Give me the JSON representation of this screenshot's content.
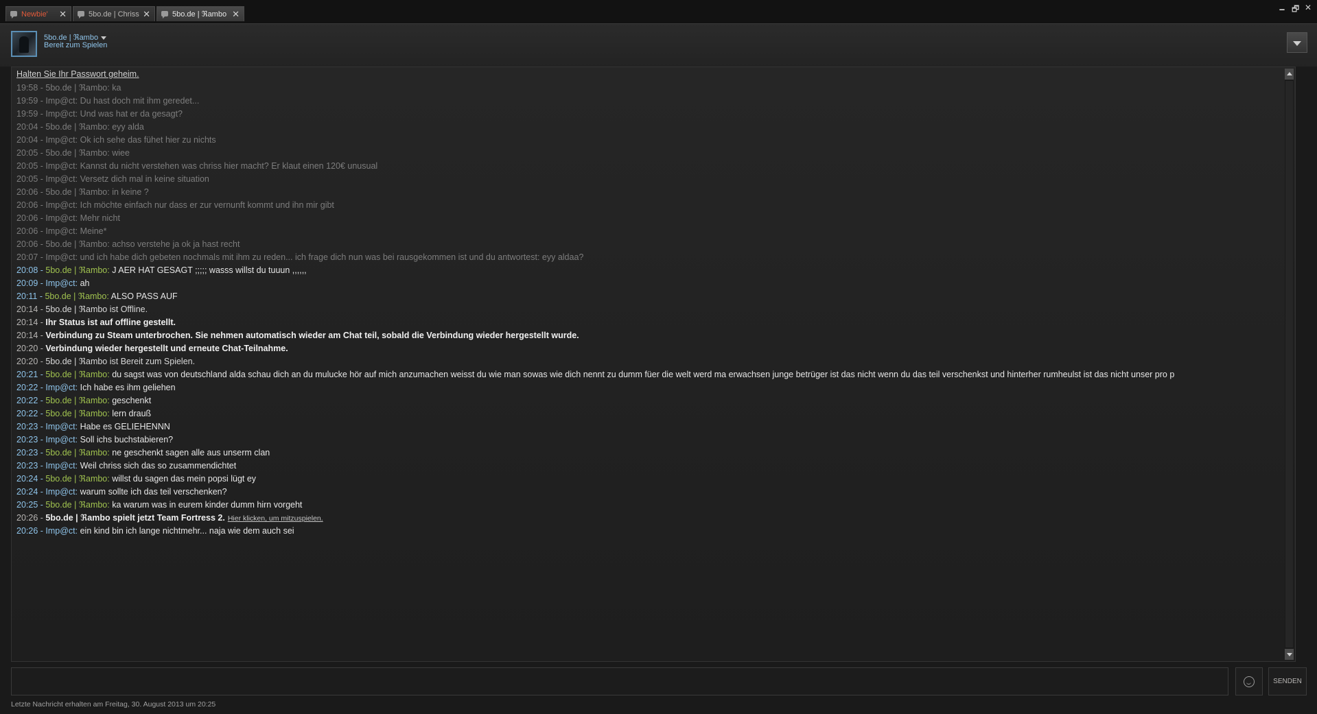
{
  "tabs": [
    {
      "label": "Newbie'",
      "close": "✕"
    },
    {
      "label": "5bo.de | Chriss",
      "close": "✕"
    },
    {
      "label": "5bo.de | ℜambo",
      "close": "✕"
    }
  ],
  "window_controls": {
    "minimize": "🗕",
    "maximize": "🗗",
    "close": "✕"
  },
  "header": {
    "name": "5bo.de | ℜambo",
    "status": "Bereit zum Spielen"
  },
  "chat": {
    "warning": "Halten Sie Ihr Passwort geheim.",
    "messages": [
      {
        "kind": "old",
        "time": "19:58",
        "sender": "5bo.de | ℜambo",
        "text": "ka"
      },
      {
        "kind": "old",
        "time": "19:59",
        "sender": "Imp@ct",
        "text": "Du hast doch mit ihm geredet..."
      },
      {
        "kind": "old",
        "time": "19:59",
        "sender": "Imp@ct",
        "text": "Und was hat er da gesagt?"
      },
      {
        "kind": "old",
        "time": "20:04",
        "sender": "5bo.de | ℜambo",
        "text": "eyy alda"
      },
      {
        "kind": "old",
        "time": "20:04",
        "sender": "Imp@ct",
        "text": "Ok ich sehe das fühet hier zu nichts"
      },
      {
        "kind": "old",
        "time": "20:05",
        "sender": "5bo.de | ℜambo",
        "text": "wiee"
      },
      {
        "kind": "old",
        "time": "20:05",
        "sender": "Imp@ct",
        "text": "Kannst du nicht verstehen was chriss hier macht? Er klaut einen 120€ unusual"
      },
      {
        "kind": "old",
        "time": "20:05",
        "sender": "Imp@ct",
        "text": "Versetz dich mal in keine situation"
      },
      {
        "kind": "old",
        "time": "20:06",
        "sender": "5bo.de | ℜambo",
        "text": "in keine ?"
      },
      {
        "kind": "old",
        "time": "20:06",
        "sender": "Imp@ct",
        "text": "Ich möchte einfach nur dass er zur vernunft kommt und ihn mir gibt"
      },
      {
        "kind": "old",
        "time": "20:06",
        "sender": "Imp@ct",
        "text": "Mehr nicht"
      },
      {
        "kind": "old",
        "time": "20:06",
        "sender": "Imp@ct",
        "text": "Meine*"
      },
      {
        "kind": "old",
        "time": "20:06",
        "sender": "5bo.de | ℜambo",
        "text": "achso verstehe ja ok ja hast recht"
      },
      {
        "kind": "old",
        "time": "20:07",
        "sender": "Imp@ct",
        "text": "und ich habe dich gebeten nochmals mit ihm zu reden... ich frage dich nun was bei rausgekommen ist und du antwortest: eyy aldaa?"
      },
      {
        "kind": "new",
        "time": "20:08",
        "sender": "5bo.de | ℜambo",
        "role": "friend",
        "text": "J AER HAT GESAGT ;;;;; wasss willst du tuuun ,,,,,,"
      },
      {
        "kind": "new",
        "time": "20:09",
        "sender": "Imp@ct",
        "role": "me",
        "text": "ah"
      },
      {
        "kind": "new",
        "time": "20:11",
        "sender": "5bo.de | ℜambo",
        "role": "friend",
        "text": "ALSO PASS AUF"
      },
      {
        "kind": "note",
        "time": "20:14",
        "text": "5bo.de | ℜambo ist Offline."
      },
      {
        "kind": "sys",
        "time": "20:14",
        "text": "Ihr Status ist auf offline gestellt."
      },
      {
        "kind": "sys",
        "time": "20:14",
        "text": "Verbindung zu Steam unterbrochen. Sie nehmen automatisch wieder am Chat teil, sobald die Verbindung wieder hergestellt wurde."
      },
      {
        "kind": "sys",
        "time": "20:20",
        "text": "Verbindung wieder hergestellt und erneute Chat-Teilnahme."
      },
      {
        "kind": "note",
        "time": "20:20",
        "text": "5bo.de | ℜambo ist Bereit zum Spielen."
      },
      {
        "kind": "new",
        "time": "20:21",
        "sender": "5bo.de | ℜambo",
        "role": "friend",
        "text": "du sagst was von deutschland alda schau dich an du mulucke hör auf mich anzumachen weisst du wie man sowas wie dich nennt zu dumm füer die welt werd ma erwachsen junge betrüger ist das nicht wenn du das teil verschenkst und hinterher rumheulst ist das nicht unser pro p"
      },
      {
        "kind": "new",
        "time": "20:22",
        "sender": "Imp@ct",
        "role": "me",
        "text": "Ich habe es ihm geliehen"
      },
      {
        "kind": "new",
        "time": "20:22",
        "sender": "5bo.de | ℜambo",
        "role": "friend",
        "text": "geschenkt"
      },
      {
        "kind": "new",
        "time": "20:22",
        "sender": "5bo.de | ℜambo",
        "role": "friend",
        "text": "lern drauß"
      },
      {
        "kind": "new",
        "time": "20:23",
        "sender": "Imp@ct",
        "role": "me",
        "text": "Habe es GELIEHENNN"
      },
      {
        "kind": "new",
        "time": "20:23",
        "sender": "Imp@ct",
        "role": "me",
        "text": "Soll ichs buchstabieren?"
      },
      {
        "kind": "new",
        "time": "20:23",
        "sender": "5bo.de | ℜambo",
        "role": "friend",
        "text": "ne geschenkt sagen alle aus unserm clan"
      },
      {
        "kind": "new",
        "time": "20:23",
        "sender": "Imp@ct",
        "role": "me",
        "text": "Weil chriss sich das so zusammendichtet"
      },
      {
        "kind": "new",
        "time": "20:24",
        "sender": "5bo.de | ℜambo",
        "role": "friend",
        "text": "willst du sagen das mein popsi lügt ey"
      },
      {
        "kind": "new",
        "time": "20:24",
        "sender": "Imp@ct",
        "role": "me",
        "text": "warum sollte ich das teil verschenken?"
      },
      {
        "kind": "new",
        "time": "20:25",
        "sender": "5bo.de | ℜambo",
        "role": "friend",
        "text": "ka warum was in eurem kinder dumm hirn vorgeht"
      },
      {
        "kind": "sys",
        "time": "20:26",
        "text": "5bo.de | ℜambo spielt jetzt Team Fortress 2.",
        "link": "Hier klicken, um mitzuspielen."
      },
      {
        "kind": "new",
        "time": "20:26",
        "sender": "Imp@ct",
        "role": "me",
        "text": "ein kind bin ich lange nichtmehr... naja wie dem auch sei"
      }
    ]
  },
  "composer": {
    "placeholder": ""
  },
  "send_label": "SENDEN",
  "emoticon_icon": "smiley-icon",
  "footer": "Letzte Nachricht erhalten am Freitag, 30. August 2013 um 20:25"
}
